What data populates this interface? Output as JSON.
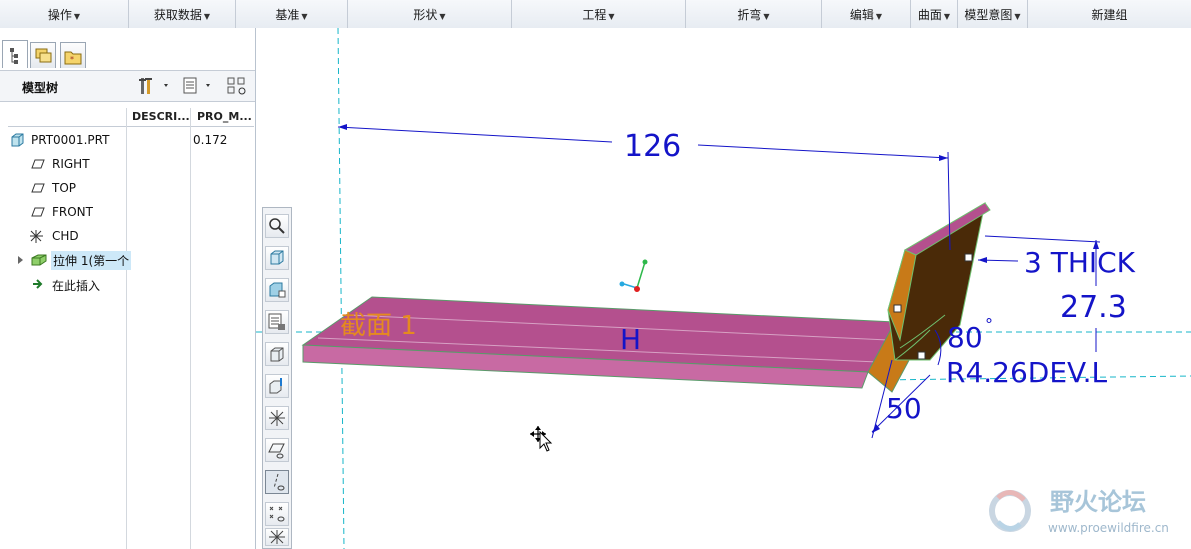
{
  "ribbon": {
    "groups": [
      "操作",
      "获取数据",
      "基准",
      "形状",
      "工程",
      "折弯",
      "编辑",
      "曲面",
      "模型意图",
      "新建组"
    ]
  },
  "model_tree": {
    "title": "模型树",
    "columns": [
      "DESCRI...",
      "PRO_M..."
    ],
    "items": [
      {
        "label": "PRT0001.PRT",
        "value": "0.172",
        "icon": "part-icon"
      },
      {
        "label": "RIGHT",
        "icon": "datum-plane-icon"
      },
      {
        "label": "TOP",
        "icon": "datum-plane-icon"
      },
      {
        "label": "FRONT",
        "icon": "datum-plane-icon"
      },
      {
        "label": "CHD",
        "icon": "coordinate-system-icon"
      },
      {
        "label": "拉伸 1(第一个",
        "icon": "extrude-feature-icon"
      },
      {
        "label": "在此插入",
        "icon": "insert-here-arrow-icon"
      }
    ]
  },
  "graphics": {
    "dim_width": "126",
    "thick_label": "3 THICK",
    "dim_height": "27.3",
    "angle_value": "80",
    "degree_sign": "°",
    "radius_label": "R4.26DEV.L",
    "dim_offset": "50",
    "section_label": "截面 1",
    "h_label": "H"
  },
  "watermark": {
    "title": "野火论坛",
    "url": "www.proewildfire.cn"
  },
  "colors": {
    "dimension": "#1414c8",
    "section": "#e58a1f",
    "sheet_face": "#b4508e",
    "flange_dark": "#4a2a08",
    "flange_light": "#c87a18"
  }
}
